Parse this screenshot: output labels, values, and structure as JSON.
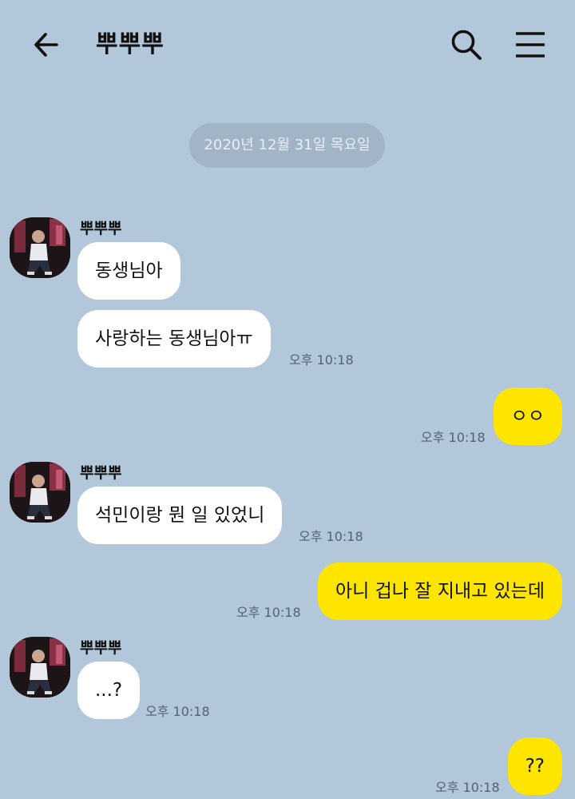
{
  "header": {
    "title": "뿌뿌뿌",
    "back_icon": "arrow-left-icon",
    "search_icon": "search-icon",
    "menu_icon": "hamburger-menu-icon"
  },
  "date_divider": "2020년 12월 31일 목요일",
  "colors": {
    "background": "#b2c7d9",
    "incoming_bubble": "#ffffff",
    "outgoing_bubble": "#fee500",
    "date_pill": "#a1b5c6"
  },
  "messages": [
    {
      "sender": "뿌뿌뿌",
      "direction": "incoming",
      "texts": [
        "동생님아",
        "사랑하는 동생님아ㅠ"
      ],
      "time": "오후 10:18"
    },
    {
      "direction": "outgoing",
      "texts": [
        "ㅇㅇ"
      ],
      "time": "오후 10:18"
    },
    {
      "sender": "뿌뿌뿌",
      "direction": "incoming",
      "texts": [
        "석민이랑 뭔 일 있었니"
      ],
      "time": "오후 10:18"
    },
    {
      "direction": "outgoing",
      "texts": [
        "아니 겁나 잘 지내고 있는데"
      ],
      "time": "오후 10:18"
    },
    {
      "sender": "뿌뿌뿌",
      "direction": "incoming",
      "texts": [
        "...?"
      ],
      "time": "오후 10:18"
    },
    {
      "direction": "outgoing",
      "texts": [
        "??"
      ],
      "time": "오후 10:18"
    }
  ]
}
